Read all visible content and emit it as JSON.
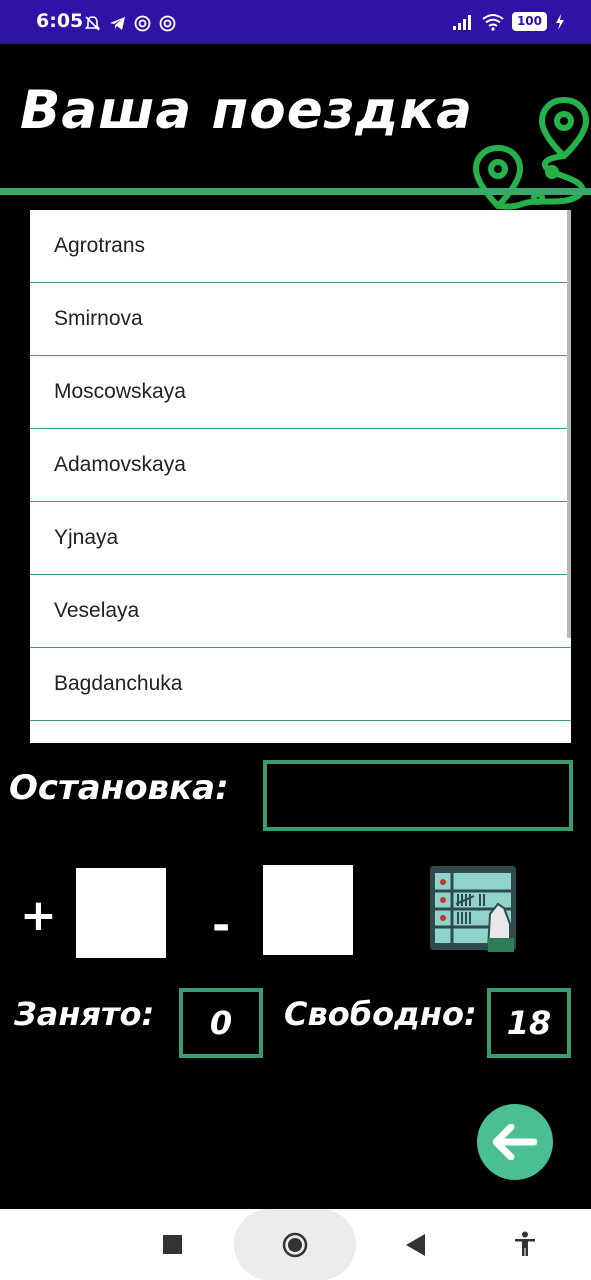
{
  "status_bar": {
    "time": "6:05",
    "battery": "100",
    "icons": [
      "notifications-off-icon",
      "telegram-icon",
      "at-icon",
      "at-icon",
      "signal-icon",
      "wifi-icon",
      "battery-icon",
      "charging-icon"
    ]
  },
  "header": {
    "title": "Ваша поездка",
    "icon": "route-map-icon",
    "accent_color": "#3aa86b"
  },
  "stops": [
    {
      "name": "Agrotrans"
    },
    {
      "name": "Smirnova"
    },
    {
      "name": "Moscowskaya"
    },
    {
      "name": "Adamovskaya"
    },
    {
      "name": "Yjnaya"
    },
    {
      "name": "Veselaya"
    },
    {
      "name": "Bagdanchuka"
    },
    {
      "name": ""
    }
  ],
  "stop_field": {
    "label": "Остановка:",
    "value": ""
  },
  "counter": {
    "plus_label": "+",
    "minus_label": "-",
    "plus_value": "",
    "minus_value": "",
    "icon": "tally-counter-icon"
  },
  "seats": {
    "occupied_label": "Занято:",
    "occupied_value": "0",
    "free_label": "Свободно:",
    "free_value": "18"
  },
  "back_button": {
    "icon": "arrow-left-icon",
    "color": "#4bbf91"
  },
  "nav_bar": {
    "icons": [
      "recents-icon",
      "home-icon",
      "back-icon",
      "accessibility-icon"
    ]
  }
}
